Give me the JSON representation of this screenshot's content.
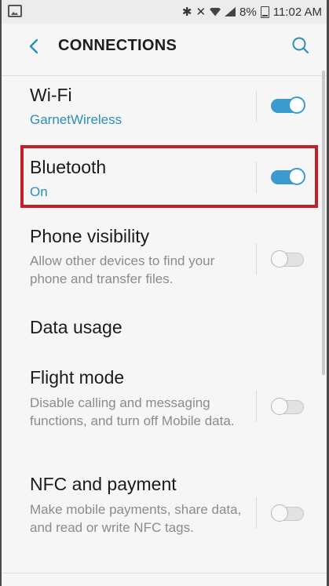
{
  "status_bar": {
    "icons": [
      "image-notification-icon",
      "bluetooth-icon",
      "mute-vibrate-icon",
      "wifi-icon",
      "signal-icon",
      "battery-icon"
    ],
    "battery": "8%",
    "time": "11:02 AM"
  },
  "header": {
    "title": "CONNECTIONS",
    "back_icon": "chevron-left-icon",
    "search_icon": "search-icon"
  },
  "settings": [
    {
      "title": "Wi-Fi",
      "subtitle": "GarnetWireless",
      "toggle": "on",
      "highlighted": false
    },
    {
      "title": "Bluetooth",
      "subtitle": "On",
      "toggle": "on",
      "highlighted": true
    },
    {
      "title": "Phone visibility",
      "subtitle": "Allow other devices to find your phone and transfer files.",
      "toggle": "off"
    },
    {
      "title": "Data usage"
    },
    {
      "title": "Flight mode",
      "subtitle": "Disable calling and messaging functions, and turn off Mobile data.",
      "toggle": "off"
    },
    {
      "title": "NFC and payment",
      "subtitle": "Make mobile payments, share data, and read or write NFC tags.",
      "toggle": "off"
    }
  ],
  "colors": {
    "accent": "#3b9bd0",
    "accent_text": "#2c8fb8",
    "highlight_border": "#c0202a"
  }
}
